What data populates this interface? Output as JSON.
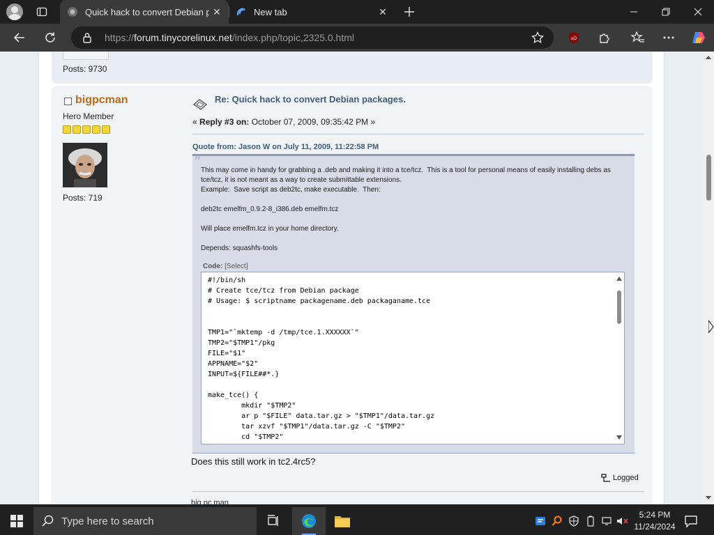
{
  "browser": {
    "tabs": [
      {
        "title": "Quick hack to convert Debian pac",
        "active": true
      },
      {
        "title": "New tab",
        "active": false
      }
    ],
    "url_prefix": "https://",
    "url_host": "forum.tinycorelinux.net",
    "url_path": "/index.php/topic,2325.0.html"
  },
  "previous_post": {
    "posts": "Posts: 9730"
  },
  "post": {
    "poster_name": "bigpcman",
    "poster_rank": "Hero Member",
    "star_count": 5,
    "poster_posts": "Posts: 719",
    "title": "Re: Quick hack to convert Debian packages.",
    "reply_prefix": "«",
    "reply_label": "Reply #3 on:",
    "reply_date": "October 07, 2009, 09:35:42 PM »",
    "quote_header": "Quote from: Jason W on July 11, 2009, 11:22:58 PM",
    "quote_lines": [
      "This may come in handy for grabbing a .deb and making it into a tce/tcz.  This is a tool for personal means of easily installing debs as tce/tcz, it is not meant as a way to create submittable extensions.",
      "Example:  Save script as deb2tc, make executable.  Then:",
      "",
      "deb2tc emelfm_0.9.2-8_i386.deb emelfm.tcz",
      "",
      "Will place emelfm.tcz in your home directory.",
      "",
      "Depends: squashfs-tools"
    ],
    "code_label": "Code:",
    "code_select": "[Select]",
    "code": "#!/bin/sh\n# Create tce/tcz from Debian package\n# Usage: $ scriptname packagename.deb packaganame.tce\n\n\nTMP1=\"`mktemp -d /tmp/tce.1.XXXXXX`\"\nTMP2=\"$TMP1\"/pkg\nFILE=\"$1\"\nAPPNAME=\"$2\"\nINPUT=${FILE##*.}\n\nmake_tce() {\n        mkdir \"$TMP2\"\n        ar p \"$FILE\" data.tar.gz > \"$TMP1\"/data.tar.gz\n        tar xzvf \"$TMP1\"/data.tar.gz -C \"$TMP2\"\n        cd \"$TMP2\"",
    "body": "Does this still work in tc2.4rc5?",
    "logged": "Logged",
    "signature": "big pc man"
  },
  "taskbar": {
    "search_placeholder": "Type here to search",
    "time": "5:24 PM",
    "date": "11/24/2024"
  },
  "colors": {
    "poster_name": "#b96d1a",
    "title": "#3f5d78",
    "quote_bg": "#d7dce8",
    "star": "#f2d43b"
  }
}
